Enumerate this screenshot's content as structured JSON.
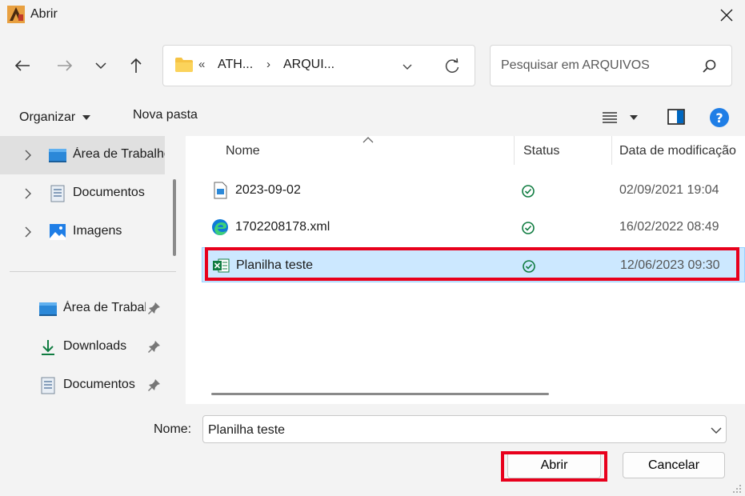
{
  "window": {
    "title": "Abrir"
  },
  "address": {
    "overflow_chevron": "«",
    "segments": [
      "ATH...",
      "ARQUI..."
    ],
    "separator": "›"
  },
  "search": {
    "placeholder": "Pesquisar em ARQUIVOS"
  },
  "toolbar": {
    "organize_label": "Organizar",
    "new_folder_label": "Nova pasta"
  },
  "sidebar": {
    "items": [
      {
        "label": "Área de Trabalho",
        "icon": "desktop-icon",
        "expandable": true,
        "selected": true
      },
      {
        "label": "Documentos",
        "icon": "document-icon",
        "expandable": true
      },
      {
        "label": "Imagens",
        "icon": "image-icon",
        "expandable": true
      },
      {
        "label": "Área de Trabalho",
        "icon": "desktop-icon",
        "pinned": true
      },
      {
        "label": "Downloads",
        "icon": "download-icon",
        "pinned": true
      },
      {
        "label": "Documentos",
        "icon": "document-icon",
        "pinned": true
      }
    ]
  },
  "filelist": {
    "columns": [
      "Nome",
      "Status",
      "Data de modificação"
    ],
    "rows": [
      {
        "name": "2023-09-02",
        "icon": "doc-file-icon",
        "status": "synced-check-icon",
        "modified": "02/09/2021 19:04"
      },
      {
        "name": "1702208178.xml",
        "icon": "edge-icon",
        "status": "synced-check-icon",
        "modified": "16/02/2022 08:49"
      },
      {
        "name": "Planilha teste",
        "icon": "excel-icon",
        "status": "synced-check-icon",
        "modified": "12/06/2023 09:30",
        "selected": true
      }
    ]
  },
  "footer": {
    "name_label": "Nome:",
    "name_value": "Planilha teste",
    "open_label": "Abrir",
    "cancel_label": "Cancelar"
  },
  "colors": {
    "highlight": "#e8001c",
    "selection": "#cce8ff",
    "accent": "#0067c0",
    "excel": "#107c41",
    "status_ok": "#107c41"
  }
}
